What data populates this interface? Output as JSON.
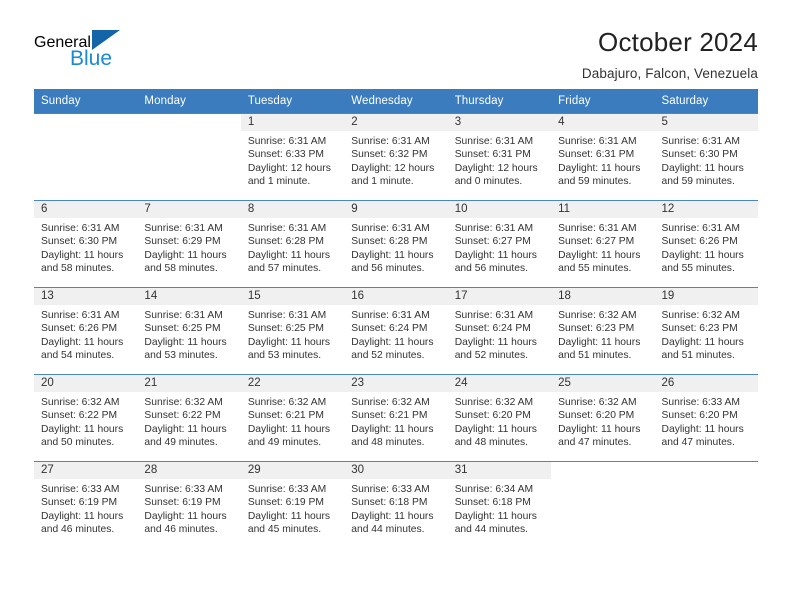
{
  "brand": {
    "name_part1": "General",
    "name_part2": "Blue",
    "triangle_color": "#1464a8",
    "blue_color": "#1b8ad4"
  },
  "header": {
    "title": "October 2024",
    "subtitle": "Dabajuro, Falcon, Venezuela"
  },
  "calendar": {
    "accent_color": "#3a7cbe",
    "daynum_bg": "#f0f0f0",
    "weekday_headers": [
      "Sunday",
      "Monday",
      "Tuesday",
      "Wednesday",
      "Thursday",
      "Friday",
      "Saturday"
    ],
    "weeks": [
      [
        {
          "day": "",
          "empty": true
        },
        {
          "day": "",
          "empty": true
        },
        {
          "day": "1",
          "sunrise": "Sunrise: 6:31 AM",
          "sunset": "Sunset: 6:33 PM",
          "daylight": "Daylight: 12 hours and 1 minute."
        },
        {
          "day": "2",
          "sunrise": "Sunrise: 6:31 AM",
          "sunset": "Sunset: 6:32 PM",
          "daylight": "Daylight: 12 hours and 1 minute."
        },
        {
          "day": "3",
          "sunrise": "Sunrise: 6:31 AM",
          "sunset": "Sunset: 6:31 PM",
          "daylight": "Daylight: 12 hours and 0 minutes."
        },
        {
          "day": "4",
          "sunrise": "Sunrise: 6:31 AM",
          "sunset": "Sunset: 6:31 PM",
          "daylight": "Daylight: 11 hours and 59 minutes."
        },
        {
          "day": "5",
          "sunrise": "Sunrise: 6:31 AM",
          "sunset": "Sunset: 6:30 PM",
          "daylight": "Daylight: 11 hours and 59 minutes."
        }
      ],
      [
        {
          "day": "6",
          "sunrise": "Sunrise: 6:31 AM",
          "sunset": "Sunset: 6:30 PM",
          "daylight": "Daylight: 11 hours and 58 minutes."
        },
        {
          "day": "7",
          "sunrise": "Sunrise: 6:31 AM",
          "sunset": "Sunset: 6:29 PM",
          "daylight": "Daylight: 11 hours and 58 minutes."
        },
        {
          "day": "8",
          "sunrise": "Sunrise: 6:31 AM",
          "sunset": "Sunset: 6:28 PM",
          "daylight": "Daylight: 11 hours and 57 minutes."
        },
        {
          "day": "9",
          "sunrise": "Sunrise: 6:31 AM",
          "sunset": "Sunset: 6:28 PM",
          "daylight": "Daylight: 11 hours and 56 minutes."
        },
        {
          "day": "10",
          "sunrise": "Sunrise: 6:31 AM",
          "sunset": "Sunset: 6:27 PM",
          "daylight": "Daylight: 11 hours and 56 minutes."
        },
        {
          "day": "11",
          "sunrise": "Sunrise: 6:31 AM",
          "sunset": "Sunset: 6:27 PM",
          "daylight": "Daylight: 11 hours and 55 minutes."
        },
        {
          "day": "12",
          "sunrise": "Sunrise: 6:31 AM",
          "sunset": "Sunset: 6:26 PM",
          "daylight": "Daylight: 11 hours and 55 minutes."
        }
      ],
      [
        {
          "day": "13",
          "sunrise": "Sunrise: 6:31 AM",
          "sunset": "Sunset: 6:26 PM",
          "daylight": "Daylight: 11 hours and 54 minutes."
        },
        {
          "day": "14",
          "sunrise": "Sunrise: 6:31 AM",
          "sunset": "Sunset: 6:25 PM",
          "daylight": "Daylight: 11 hours and 53 minutes."
        },
        {
          "day": "15",
          "sunrise": "Sunrise: 6:31 AM",
          "sunset": "Sunset: 6:25 PM",
          "daylight": "Daylight: 11 hours and 53 minutes."
        },
        {
          "day": "16",
          "sunrise": "Sunrise: 6:31 AM",
          "sunset": "Sunset: 6:24 PM",
          "daylight": "Daylight: 11 hours and 52 minutes."
        },
        {
          "day": "17",
          "sunrise": "Sunrise: 6:31 AM",
          "sunset": "Sunset: 6:24 PM",
          "daylight": "Daylight: 11 hours and 52 minutes."
        },
        {
          "day": "18",
          "sunrise": "Sunrise: 6:32 AM",
          "sunset": "Sunset: 6:23 PM",
          "daylight": "Daylight: 11 hours and 51 minutes."
        },
        {
          "day": "19",
          "sunrise": "Sunrise: 6:32 AM",
          "sunset": "Sunset: 6:23 PM",
          "daylight": "Daylight: 11 hours and 51 minutes."
        }
      ],
      [
        {
          "day": "20",
          "sunrise": "Sunrise: 6:32 AM",
          "sunset": "Sunset: 6:22 PM",
          "daylight": "Daylight: 11 hours and 50 minutes."
        },
        {
          "day": "21",
          "sunrise": "Sunrise: 6:32 AM",
          "sunset": "Sunset: 6:22 PM",
          "daylight": "Daylight: 11 hours and 49 minutes."
        },
        {
          "day": "22",
          "sunrise": "Sunrise: 6:32 AM",
          "sunset": "Sunset: 6:21 PM",
          "daylight": "Daylight: 11 hours and 49 minutes."
        },
        {
          "day": "23",
          "sunrise": "Sunrise: 6:32 AM",
          "sunset": "Sunset: 6:21 PM",
          "daylight": "Daylight: 11 hours and 48 minutes."
        },
        {
          "day": "24",
          "sunrise": "Sunrise: 6:32 AM",
          "sunset": "Sunset: 6:20 PM",
          "daylight": "Daylight: 11 hours and 48 minutes."
        },
        {
          "day": "25",
          "sunrise": "Sunrise: 6:32 AM",
          "sunset": "Sunset: 6:20 PM",
          "daylight": "Daylight: 11 hours and 47 minutes."
        },
        {
          "day": "26",
          "sunrise": "Sunrise: 6:33 AM",
          "sunset": "Sunset: 6:20 PM",
          "daylight": "Daylight: 11 hours and 47 minutes."
        }
      ],
      [
        {
          "day": "27",
          "sunrise": "Sunrise: 6:33 AM",
          "sunset": "Sunset: 6:19 PM",
          "daylight": "Daylight: 11 hours and 46 minutes."
        },
        {
          "day": "28",
          "sunrise": "Sunrise: 6:33 AM",
          "sunset": "Sunset: 6:19 PM",
          "daylight": "Daylight: 11 hours and 46 minutes."
        },
        {
          "day": "29",
          "sunrise": "Sunrise: 6:33 AM",
          "sunset": "Sunset: 6:19 PM",
          "daylight": "Daylight: 11 hours and 45 minutes."
        },
        {
          "day": "30",
          "sunrise": "Sunrise: 6:33 AM",
          "sunset": "Sunset: 6:18 PM",
          "daylight": "Daylight: 11 hours and 44 minutes."
        },
        {
          "day": "31",
          "sunrise": "Sunrise: 6:34 AM",
          "sunset": "Sunset: 6:18 PM",
          "daylight": "Daylight: 11 hours and 44 minutes."
        },
        {
          "day": "",
          "empty": true
        },
        {
          "day": "",
          "empty": true
        }
      ]
    ]
  }
}
